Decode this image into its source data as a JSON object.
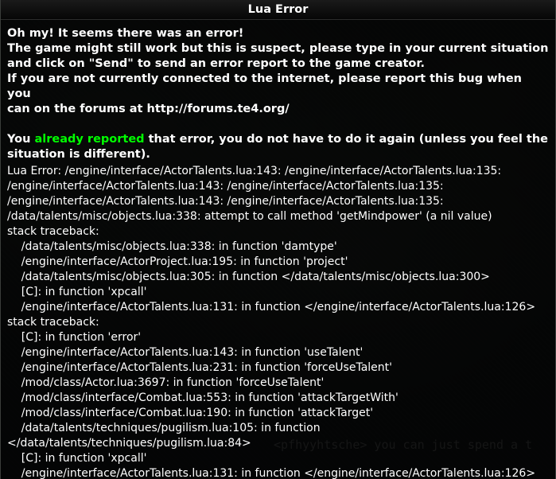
{
  "dialog": {
    "title": "Lua Error",
    "intro_lines": [
      "Oh my! It seems there was an error!",
      "The game might still work but this is suspect, please type in your current situation",
      "and click on \"Send\" to send an error report to the game creator.",
      "If you are not currently connected to the internet, please report this bug when you",
      "can on the forums at http://forums.te4.org/"
    ],
    "reported": {
      "prefix": "You ",
      "highlight": "already reported",
      "suffix": " that error, you do not have to do it again (unless you feel the",
      "line2": "situation is different)."
    },
    "trace_lines": [
      "Lua Error: /engine/interface/ActorTalents.lua:143: /engine/interface/ActorTalents.lua:135:",
      "/engine/interface/ActorTalents.lua:143: /engine/interface/ActorTalents.lua:135:",
      "/engine/interface/ActorTalents.lua:143: /engine/interface/ActorTalents.lua:135:",
      "/data/talents/misc/objects.lua:338: attempt to call method 'getMindpower' (a nil value)",
      "stack traceback:",
      "    /data/talents/misc/objects.lua:338: in function 'damtype'",
      "    /engine/interface/ActorProject.lua:195: in function 'project'",
      "    /data/talents/misc/objects.lua:305: in function </data/talents/misc/objects.lua:300>",
      "    [C]: in function 'xpcall'",
      "    /engine/interface/ActorTalents.lua:131: in function </engine/interface/ActorTalents.lua:126>",
      "stack traceback:",
      "    [C]: in function 'error'",
      "    /engine/interface/ActorTalents.lua:143: in function 'useTalent'",
      "    /engine/interface/ActorTalents.lua:231: in function 'forceUseTalent'",
      "    /mod/class/Actor.lua:3697: in function 'forceUseTalent'",
      "    /mod/class/interface/Combat.lua:553: in function 'attackTargetWith'",
      "    /mod/class/interface/Combat.lua:190: in function 'attackTarget'",
      "    /data/talents/techniques/pugilism.lua:105: in function",
      "</data/talents/techniques/pugilism.lua:84>",
      "    [C]: in function 'xpcall'",
      "    /engine/interface/ActorTalents.lua:131: in function </engine/interface/ActorTalents.lua:126>"
    ],
    "colors": {
      "highlight": "#00ff00",
      "text": "#ffffff"
    }
  },
  "background_chat": {
    "line1": "<pfhyyhtsche> you can just spend a t"
  }
}
